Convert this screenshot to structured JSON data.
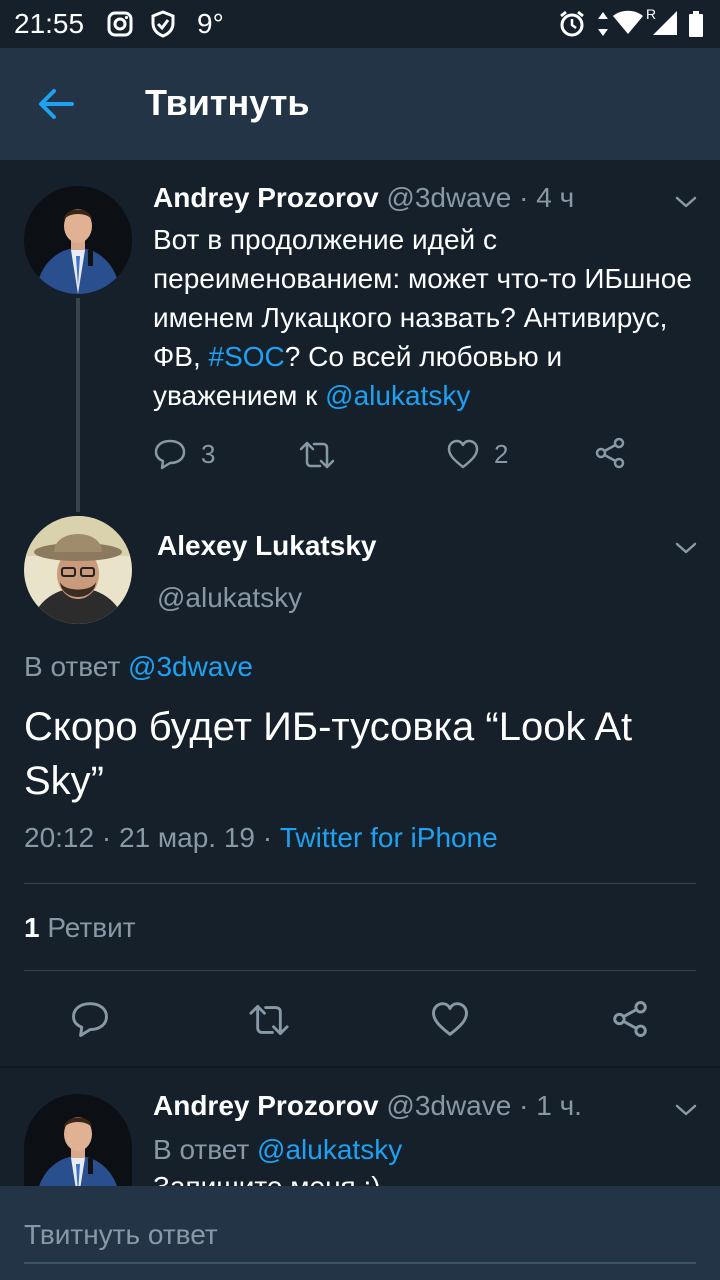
{
  "status_bar": {
    "time": "21:55",
    "temperature": "9°",
    "icons": [
      "instagram-icon",
      "shield-icon",
      "alarm-icon",
      "data-arrows-icon",
      "wifi-icon",
      "signal-icon",
      "battery-icon"
    ],
    "signal_label": "R"
  },
  "app_bar": {
    "title": "Твитнуть",
    "back_icon": "arrow-left-icon"
  },
  "tweet1": {
    "name": "Andrey Prozorov",
    "handle": "@3dwave",
    "sep": " · ",
    "time": "4 ч",
    "text_a": "Вот в продолжение идей с переименованием: может что-то ИБшное именем Лукацкого назвать? Антивирус, ФВ, ",
    "hashtag": "#SOC",
    "text_b": "? Со всей любовью и уважением к ",
    "mention": "@alukatsky",
    "reply_count": "3",
    "like_count": "2"
  },
  "tweet2": {
    "name": "Alexey Lukatsky",
    "handle": "@alukatsky",
    "reply_prefix": "В ответ ",
    "reply_to": "@3dwave",
    "text": "Скоро будет ИБ-тусовка “Look At Sky”",
    "timestamp": "20:12 · 21 мар. 19 · ",
    "source": "Twitter for iPhone",
    "retweet_count": "1",
    "retweet_label": " Ретвит"
  },
  "tweet3": {
    "name": "Andrey Prozorov",
    "handle": "@3dwave",
    "sep": " · ",
    "time": "1 ч.",
    "reply_prefix": "В ответ ",
    "reply_to": "@alukatsky",
    "text_clipped": "Запишите меня :)"
  },
  "composer": {
    "placeholder": "Твитнуть ответ"
  },
  "colors": {
    "background": "#15202b",
    "bar": "#243447",
    "accent": "#1da1f2",
    "muted": "#8899a6"
  }
}
